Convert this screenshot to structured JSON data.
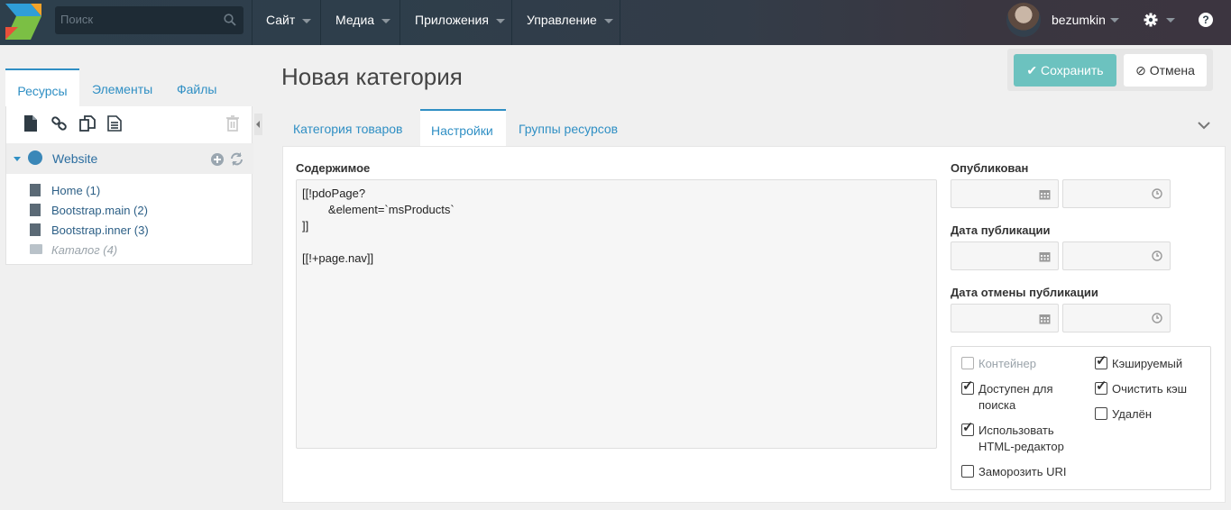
{
  "topbar": {
    "search_placeholder": "Поиск",
    "nav": [
      "Сайт",
      "Медиа",
      "Приложения",
      "Управление"
    ],
    "username": "bezumkin",
    "help": "?"
  },
  "left": {
    "tabs": [
      "Ресурсы",
      "Элементы",
      "Файлы"
    ],
    "site": "Website",
    "items": [
      "Home (1)",
      "Bootstrap.main (2)",
      "Bootstrap.inner (3)",
      "Каталог (4)"
    ]
  },
  "main": {
    "title": "Новая категория",
    "save_label": "Сохранить",
    "cancel_label": "Отмена",
    "tabs": [
      "Категория товаров",
      "Настройки",
      "Группы ресурсов"
    ],
    "content_label": "Содержимое",
    "content_text": "[[!pdoPage?\n        &element=`msProducts`\n]]\n\n[[!+page.nav]]",
    "published_label": "Опубликован",
    "pubdate_label": "Дата публикации",
    "unpubdate_label": "Дата отмены публикации",
    "checkboxes": {
      "container": "Контейнер",
      "searchable": "Доступен для поиска",
      "richtext": "Использовать HTML-редактор",
      "freeze_uri": "Заморозить URI",
      "cacheable": "Кэшируемый",
      "clear_cache": "Очистить кэш",
      "deleted": "Удалён"
    }
  },
  "colors": {
    "accent": "#2f8fc4",
    "save": "#6cc2bf",
    "topbar": "#2e3e4b"
  }
}
